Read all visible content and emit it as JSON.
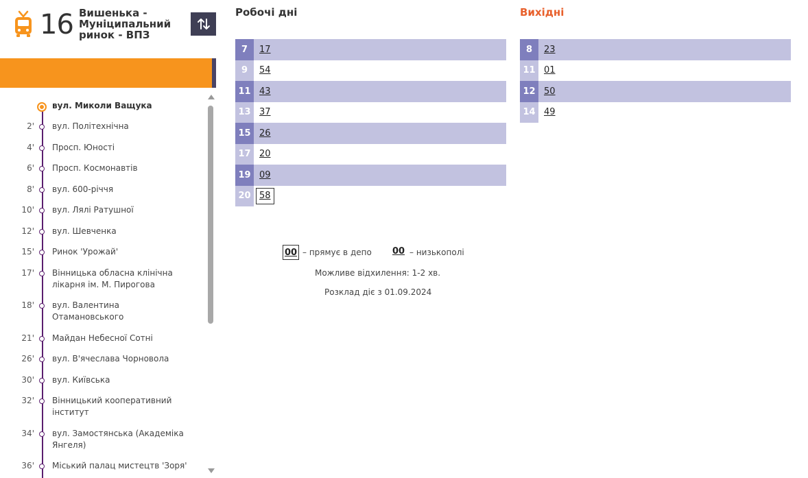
{
  "route": {
    "number": "16",
    "name": "Вишенька - Муніципальний ринок - ВПЗ",
    "icon": "trolleybus-icon",
    "accent_color": "#f7941d"
  },
  "stops": [
    {
      "time": "",
      "name": "вул. Миколи Ващука"
    },
    {
      "time": "2'",
      "name": "вул. Політехнічна"
    },
    {
      "time": "4'",
      "name": "Просп. Юності"
    },
    {
      "time": "6'",
      "name": "Просп. Космонавтів"
    },
    {
      "time": "8'",
      "name": "вул. 600-річчя"
    },
    {
      "time": "10'",
      "name": "вул. Лялі Ратушної"
    },
    {
      "time": "12'",
      "name": "вул. Шевченка"
    },
    {
      "time": "15'",
      "name": "Ринок 'Урожай'"
    },
    {
      "time": "17'",
      "name": "Вінницька обласна клінічна лікарня ім. М. Пирогова"
    },
    {
      "time": "18'",
      "name": "вул. Валентина Отамановського"
    },
    {
      "time": "21'",
      "name": "Майдан Небесної Сотні"
    },
    {
      "time": "26'",
      "name": "вул. В'ячеслава Чорновола"
    },
    {
      "time": "30'",
      "name": "вул. Київська"
    },
    {
      "time": "32'",
      "name": "Вінницький кооперативний інститут"
    },
    {
      "time": "34'",
      "name": "вул. Замостянська (Академіка Янгеля)"
    },
    {
      "time": "36'",
      "name": "Міський палац мистецтв 'Зоря'"
    }
  ],
  "schedule": {
    "workdays_title": "Робочі дні",
    "weekend_title": "Вихідні",
    "workdays": [
      {
        "hour": "7",
        "minutes": "17"
      },
      {
        "hour": "9",
        "minutes": "54"
      },
      {
        "hour": "11",
        "minutes": "43"
      },
      {
        "hour": "13",
        "minutes": "37"
      },
      {
        "hour": "15",
        "minutes": "26"
      },
      {
        "hour": "17",
        "minutes": "20"
      },
      {
        "hour": "19",
        "minutes": "09"
      },
      {
        "hour": "20",
        "minutes": "58",
        "to_depot": true
      }
    ],
    "weekend": [
      {
        "hour": "8",
        "minutes": "23"
      },
      {
        "hour": "11",
        "minutes": "01"
      },
      {
        "hour": "12",
        "minutes": "50"
      },
      {
        "hour": "14",
        "minutes": "49"
      }
    ]
  },
  "legend": {
    "depot_sample": "00",
    "depot_text": "– прямує в депо",
    "lowfloor_sample": "00",
    "lowfloor_text": "– низькополі"
  },
  "notes": {
    "deviation": "Можливе відхилення: 1-2 хв.",
    "valid_from": "Розклад діє з 01.09.2024"
  }
}
